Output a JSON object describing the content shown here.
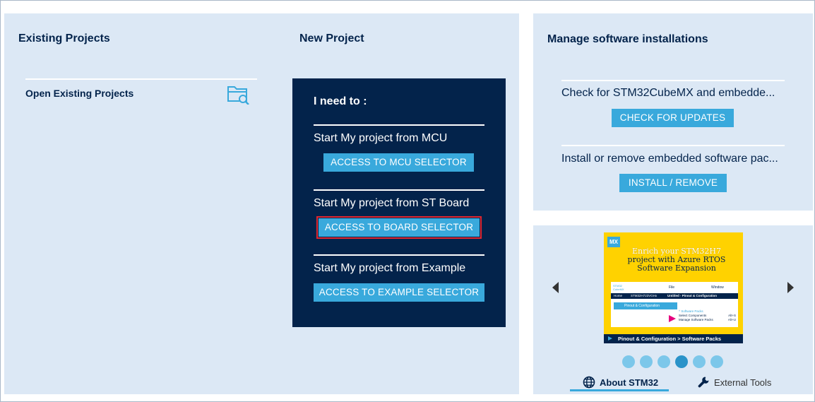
{
  "existing_projects": {
    "heading": "Existing Projects",
    "open_label": "Open Existing Projects",
    "open_icon": "folder-search-icon"
  },
  "new_project": {
    "heading": "New Project",
    "need_label": "I need to :",
    "options": [
      {
        "label": "Start My project from MCU",
        "button": "ACCESS TO MCU SELECTOR"
      },
      {
        "label": "Start My project from ST Board",
        "button": "ACCESS TO BOARD SELECTOR",
        "highlighted": true
      },
      {
        "label": "Start My project from Example",
        "button": "ACCESS TO EXAMPLE SELECTOR"
      }
    ]
  },
  "manage": {
    "heading": "Manage software installations",
    "check_text": "Check for STM32CubeMX and embedde...",
    "check_button": "CHECK FOR UPDATES",
    "install_text": "Install or remove embedded software pac...",
    "install_button": "INSTALL / REMOVE"
  },
  "carousel": {
    "banner": {
      "badge": "MX",
      "title_line1": "Enrich your STM32H7",
      "title_line2": "project with Azure RTOS",
      "title_line3": "Software Expansion",
      "shot_logo": "STM32 CubeMX",
      "shot_file": "File",
      "shot_window": "Window",
      "shot_home": "Home",
      "shot_device": "STM32H723VGHx",
      "shot_tab": "Untitled - Pinout & Configuration",
      "shot_pinout": "Pinout & Configuration",
      "shot_packs": "^ Software Packs",
      "shot_select": "Select Components",
      "shot_select_key": "Alt+S",
      "shot_manage": "Manage Software Packs",
      "shot_manage_key": "Alt+U",
      "caption": "Pinout & Configuration > Software Packs"
    },
    "dot_count": 6,
    "active_dot": 3,
    "tabs": [
      {
        "label": "About STM32",
        "icon": "globe-icon",
        "active": true
      },
      {
        "label": "External Tools",
        "icon": "wrench-icon",
        "active": false
      }
    ]
  },
  "colors": {
    "panel_bg": "#dce8f5",
    "dark_navy": "#03234b",
    "button_blue": "#39a9dc",
    "highlight_red": "#e0262f",
    "banner_yellow": "#ffd200"
  }
}
